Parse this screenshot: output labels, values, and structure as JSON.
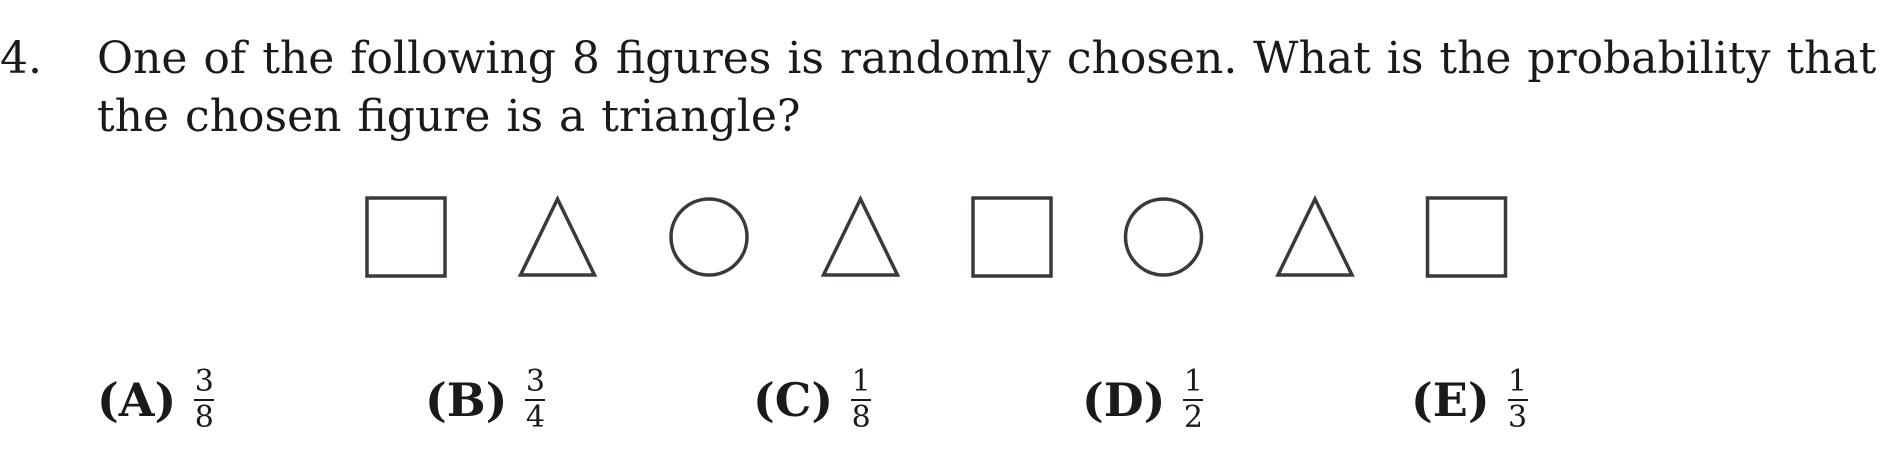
{
  "question": {
    "number": "4.",
    "text": "One of the following 8 figures is randomly chosen. What is the probability that the chosen figure is a triangle?"
  },
  "figures": [
    "square",
    "triangle",
    "circle",
    "triangle",
    "square",
    "circle",
    "triangle",
    "square"
  ],
  "shape_color": "#3a3a36",
  "choices": [
    {
      "label": "(A)",
      "num": "3",
      "den": "8"
    },
    {
      "label": "(B)",
      "num": "3",
      "den": "4"
    },
    {
      "label": "(C)",
      "num": "1",
      "den": "8"
    },
    {
      "label": "(D)",
      "num": "1",
      "den": "2"
    },
    {
      "label": "(E)",
      "num": "1",
      "den": "3"
    }
  ]
}
